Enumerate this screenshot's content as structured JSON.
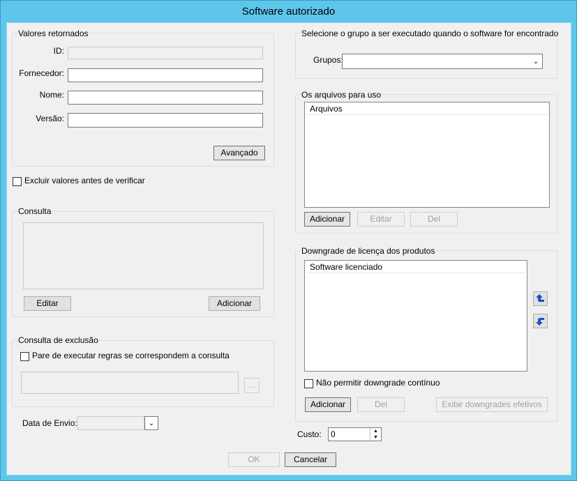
{
  "window": {
    "title": "Software autorizado"
  },
  "valores_retornados": {
    "title": "Valores retornados",
    "id_label": "ID:",
    "id_value": "",
    "fornecedor_label": "Fornecedor:",
    "fornecedor_value": "",
    "nome_label": "Nome:",
    "nome_value": "",
    "versao_label": "Versão:",
    "versao_value": "",
    "avancado_button": "Avançado"
  },
  "excluir_checkbox": {
    "label": "Excluir valores antes de verificar",
    "checked": false
  },
  "consulta": {
    "title": "Consulta",
    "editar_button": "Editar",
    "adicionar_button": "Adicionar"
  },
  "consulta_exclusao": {
    "title": "Consulta de exclusão",
    "checkbox_label": "Pare de executar regras se correspondem a consulta",
    "checked": false,
    "browse_button": "..."
  },
  "data_envio": {
    "label": "Data de Envio:",
    "value": ""
  },
  "grupo": {
    "title": "Selecione o grupo a ser executado quando o software for encontrado",
    "grupos_label": "Grupos:",
    "grupos_value": ""
  },
  "arquivos": {
    "title": "Os arquivos para uso",
    "column_header": "Arquivos",
    "adicionar_button": "Adicionar",
    "editar_button": "Editar",
    "del_button": "Del"
  },
  "downgrade": {
    "title": "Downgrade de licença dos produtos",
    "column_header": "Software licenciado",
    "checkbox_label": "Não permitir downgrade contínuo",
    "checked": false,
    "adicionar_button": "Adicionar",
    "del_button": "Del",
    "exibir_button": "Exibir downgrades efetivos",
    "move_up_icon": "arrow-up-icon",
    "move_down_icon": "arrow-down-icon"
  },
  "custo": {
    "label": "Custo:",
    "value": "0"
  },
  "footer": {
    "ok_button": "OK",
    "cancelar_button": "Cancelar"
  }
}
